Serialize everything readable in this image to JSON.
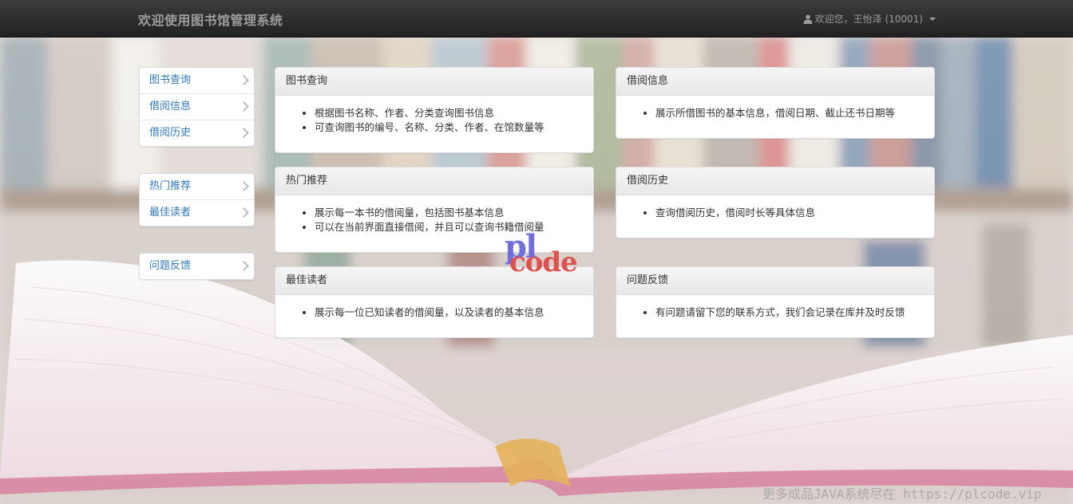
{
  "navbar": {
    "brand": "欢迎使用图书馆管理系统",
    "user_label": "欢迎您，王怡泽 (10001)"
  },
  "sidebar": {
    "groups": [
      {
        "items": [
          {
            "label": "图书查询"
          },
          {
            "label": "借阅信息"
          },
          {
            "label": "借阅历史"
          }
        ]
      },
      {
        "items": [
          {
            "label": "热门推荐"
          },
          {
            "label": "最佳读者"
          }
        ]
      },
      {
        "items": [
          {
            "label": "问题反馈"
          }
        ]
      }
    ]
  },
  "panels": {
    "book_search": {
      "title": "图书查询",
      "lines": [
        "根据图书名称、作者、分类查询图书信息",
        "可查询图书的编号、名称、分类、作者、在馆数量等"
      ]
    },
    "borrow_info": {
      "title": "借阅信息",
      "lines": [
        "展示所借图书的基本信息，借阅日期、截止还书日期等"
      ]
    },
    "hot": {
      "title": "热门推荐",
      "lines": [
        "展示每一本书的借阅量，包括图书基本信息",
        "可以在当前界面直接借阅，并且可以查询书籍借阅量"
      ]
    },
    "history": {
      "title": "借阅历史",
      "lines": [
        "查询借阅历史，借阅时长等具体信息"
      ]
    },
    "best_reader": {
      "title": "最佳读者",
      "lines": [
        "展示每一位已知读者的借阅量，以及读者的基本信息"
      ]
    },
    "feedback": {
      "title": "问题反馈",
      "lines": [
        "有问题请留下您的联系方式，我们会记录在库并及时反馈"
      ]
    }
  },
  "watermark": {
    "logo_top": "pl",
    "logo_bottom": "code",
    "footer": "更多成品JAVA系统尽在 https://plcode.vip"
  }
}
